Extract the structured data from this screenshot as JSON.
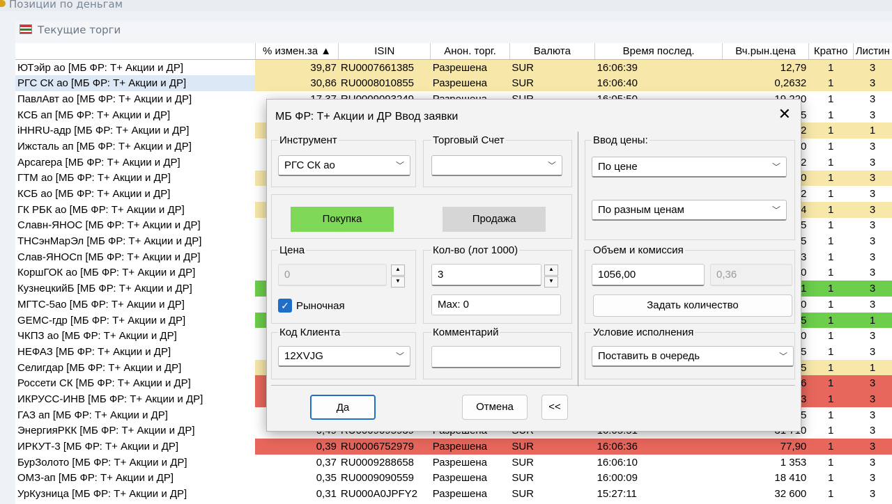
{
  "window_title": "Позиции по деньгам",
  "panel_title": "Текущие торги",
  "columns": [
    "",
    "% измен.за ▲",
    "ISIN",
    "Анон. торг.",
    "Валюта",
    "Время послед.",
    "Вч.рын.цена",
    "Кратно",
    "Листин"
  ],
  "rows": [
    {
      "name": "ЮТэйр ао [МБ ФР: Т+ Акции и ДР]",
      "chg": "39,87",
      "isin": "RU0007661385",
      "anon": "Разрешена",
      "cur": "SUR",
      "time": "16:06:39",
      "price": "12,79",
      "mult": "1",
      "list": "3",
      "hl": "y"
    },
    {
      "name": "РГС СК ао [МБ ФР: Т+ Акции и ДР]",
      "chg": "30,86",
      "isin": "RU0008010855",
      "anon": "Разрешена",
      "cur": "SUR",
      "time": "16:06:40",
      "price": "0,2632",
      "mult": "1",
      "list": "3",
      "hl": "y",
      "sel": true
    },
    {
      "name": "ПавлАвт ао [МБ ФР: Т+ Акции и ДР]",
      "chg": "17,37",
      "isin": "RU0009093249",
      "anon": "Разрешена",
      "cur": "SUR",
      "time": "16:05:50",
      "price": "19,220",
      "mult": "1",
      "list": "3",
      "hl": ""
    },
    {
      "name": "КСБ ап [МБ ФР: Т+ Акции и ДР]",
      "chg": "",
      "isin": "",
      "anon": "",
      "cur": "",
      "time": "",
      "price": "5",
      "mult": "1",
      "list": "3",
      "hl": ""
    },
    {
      "name": "iHHRU-адр [МБ ФР: Т+ Акции и ДР]",
      "chg": "",
      "isin": "",
      "anon": "",
      "cur": "",
      "time": "",
      "price": "2",
      "mult": "1",
      "list": "1",
      "hl": "y"
    },
    {
      "name": "Ижсталь ап [МБ ФР: Т+ Акции и ДР]",
      "chg": "",
      "isin": "",
      "anon": "",
      "cur": "",
      "time": "",
      "price": "0",
      "mult": "1",
      "list": "3",
      "hl": ""
    },
    {
      "name": "Арсагера [МБ ФР: Т+ Акции и ДР]",
      "chg": "",
      "isin": "",
      "anon": "",
      "cur": "",
      "time": "",
      "price": "2",
      "mult": "1",
      "list": "3",
      "hl": ""
    },
    {
      "name": "ГТМ ао [МБ ФР: Т+ Акции и ДР]",
      "chg": "",
      "isin": "",
      "anon": "",
      "cur": "",
      "time": "",
      "price": "0",
      "mult": "1",
      "list": "3",
      "hl": "y"
    },
    {
      "name": "КСБ ао [МБ ФР: Т+ Акции и ДР]",
      "chg": "",
      "isin": "",
      "anon": "",
      "cur": "",
      "time": "",
      "price": "2",
      "mult": "1",
      "list": "3",
      "hl": ""
    },
    {
      "name": "ГК РБК ао [МБ ФР: Т+ Акции и ДР]",
      "chg": "",
      "isin": "",
      "anon": "",
      "cur": "",
      "time": "",
      "price": "4",
      "mult": "1",
      "list": "3",
      "hl": "y"
    },
    {
      "name": "Славн-ЯНОС [МБ ФР: Т+ Акции и ДР]",
      "chg": "",
      "isin": "",
      "anon": "",
      "cur": "",
      "time": "",
      "price": "5",
      "mult": "1",
      "list": "3",
      "hl": ""
    },
    {
      "name": "ТНСэнМарЭл [МБ ФР: Т+ Акции и ДР]",
      "chg": "",
      "isin": "",
      "anon": "",
      "cur": "",
      "time": "",
      "price": "5",
      "mult": "1",
      "list": "3",
      "hl": ""
    },
    {
      "name": "Слав-ЯНОСп [МБ ФР: Т+ Акции и ДР]",
      "chg": "",
      "isin": "",
      "anon": "",
      "cur": "",
      "time": "",
      "price": "3",
      "mult": "1",
      "list": "3",
      "hl": ""
    },
    {
      "name": "КоршГОК ао [МБ ФР: Т+ Акции и ДР]",
      "chg": "",
      "isin": "",
      "anon": "",
      "cur": "",
      "time": "",
      "price": "0",
      "mult": "1",
      "list": "3",
      "hl": ""
    },
    {
      "name": "КузнецкийБ [МБ ФР: Т+ Акции и ДР]",
      "chg": "",
      "isin": "",
      "anon": "",
      "cur": "",
      "time": "",
      "price": "1",
      "mult": "1",
      "list": "3",
      "hl": "g"
    },
    {
      "name": "МГТС-5ао [МБ ФР: Т+ Акции и ДР]",
      "chg": "",
      "isin": "",
      "anon": "",
      "cur": "",
      "time": "",
      "price": "0",
      "mult": "1",
      "list": "3",
      "hl": ""
    },
    {
      "name": "GEMC-гдр [МБ ФР: Т+ Акции и ДР]",
      "chg": "",
      "isin": "",
      "anon": "",
      "cur": "",
      "time": "",
      "price": "5",
      "mult": "1",
      "list": "1",
      "hl": "g"
    },
    {
      "name": "ЧКПЗ ао [МБ ФР: Т+ Акции и ДР]",
      "chg": "",
      "isin": "",
      "anon": "",
      "cur": "",
      "time": "",
      "price": "0",
      "mult": "1",
      "list": "3",
      "hl": ""
    },
    {
      "name": "НЕФАЗ [МБ ФР: Т+ Акции и ДР]",
      "chg": "",
      "isin": "",
      "anon": "",
      "cur": "",
      "time": "",
      "price": "5",
      "mult": "1",
      "list": "3",
      "hl": ""
    },
    {
      "name": "Селигдар [МБ ФР: Т+ Акции и ДР]",
      "chg": "",
      "isin": "",
      "anon": "",
      "cur": "",
      "time": "",
      "price": "5",
      "mult": "1",
      "list": "1",
      "hl": "y"
    },
    {
      "name": "Россети СК [МБ ФР: Т+ Акции и ДР]",
      "chg": "",
      "isin": "",
      "anon": "",
      "cur": "",
      "time": "",
      "price": "6",
      "mult": "1",
      "list": "3",
      "hl": "rd"
    },
    {
      "name": "ИКРУСС-ИНВ [МБ ФР: Т+ Акции и ДР]",
      "chg": "",
      "isin": "",
      "anon": "",
      "cur": "",
      "time": "",
      "price": "3",
      "mult": "1",
      "list": "3",
      "hl": "rd"
    },
    {
      "name": "ГАЗ ап [МБ ФР: Т+ Акции и ДР]",
      "chg": "",
      "isin": "",
      "anon": "",
      "cur": "",
      "time": "",
      "price": "5",
      "mult": "1",
      "list": "3",
      "hl": ""
    },
    {
      "name": "ЭнергияРКК [МБ ФР: Т+ Акции и ДР]",
      "chg": "0,49",
      "isin": "RU0009095939",
      "anon": "Разрешена",
      "cur": "SUR",
      "time": "16:05:51",
      "price": "31 710",
      "mult": "1",
      "list": "3",
      "hl": ""
    },
    {
      "name": "ИРКУТ-3 [МБ ФР: Т+ Акции и ДР]",
      "chg": "0,39",
      "isin": "RU0006752979",
      "anon": "Разрешена",
      "cur": "SUR",
      "time": "16:06:36",
      "price": "77,90",
      "mult": "1",
      "list": "3",
      "hl": "rd"
    },
    {
      "name": "БурЗолото [МБ ФР: Т+ Акции и ДР]",
      "chg": "0,37",
      "isin": "RU0009288658",
      "anon": "Разрешена",
      "cur": "SUR",
      "time": "16:06:10",
      "price": "1 353",
      "mult": "1",
      "list": "3",
      "hl": ""
    },
    {
      "name": "ОМЗ-ап [МБ ФР: Т+ Акции и ДР]",
      "chg": "0,35",
      "isin": "RU0009090559",
      "anon": "Разрешена",
      "cur": "SUR",
      "time": "16:00:09",
      "price": "18 410",
      "mult": "1",
      "list": "3",
      "hl": ""
    },
    {
      "name": "УрКузница [МБ ФР: Т+ Акции и ДР]",
      "chg": "0,31",
      "isin": "RU000A0JPFY2",
      "anon": "Разрешена",
      "cur": "SUR",
      "time": "15:27:11",
      "price": "32 600",
      "mult": "1",
      "list": "3",
      "hl": ""
    }
  ],
  "dialog": {
    "title": "МБ ФР: Т+ Акции и ДР Ввод заявки",
    "close": "✕",
    "instrument_label": "Инструмент",
    "instrument_value": "РГС СК ао",
    "account_label": "Торговый Счет",
    "account_value": "",
    "price_entry_label": "Ввод цены:",
    "price_entry_value": "По цене",
    "price_mode_value": "По разным ценам",
    "buy_label": "Покупка",
    "sell_label": "Продажа",
    "price_label": "Цена",
    "price_value": "0",
    "qty_label": "Кол-во (лот 1000)",
    "qty_value": "3",
    "max_label": "Max: 0",
    "volume_label": "Объем  и комиссия",
    "volume_value": "1056,00",
    "commission_value": "0,36",
    "set_qty_label": "Задать количество",
    "market_label": "Рыночная",
    "market_checked": true,
    "client_label": "Код Клиента",
    "client_value": "12XVJG",
    "comment_label": "Комментарий",
    "comment_value": "",
    "condition_label": "Условие исполнения",
    "condition_value": "Поставить в очередь",
    "ok_label": "Да",
    "cancel_label": "Отмена",
    "collapse_label": "<<"
  },
  "colors": {
    "highlight_yellow": "#f7e7a9",
    "highlight_green": "#6cce4b",
    "highlight_red": "#e8675c",
    "buy_green": "#7fd857"
  }
}
